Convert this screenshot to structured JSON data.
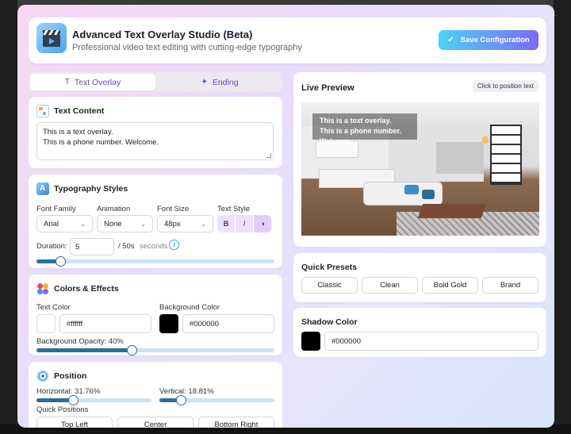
{
  "window": {
    "close_glyph": "×"
  },
  "header": {
    "icon": "clapperboard-icon",
    "title": "Advanced Text Overlay Studio (Beta)",
    "subtitle": "Professional video text editing with cutting-edge typography",
    "save_label": "Save Configuration",
    "save_glyph": "✓"
  },
  "tabs": [
    {
      "label": "Text Overlay",
      "glyph": "T",
      "active": true
    },
    {
      "label": "Ending",
      "glyph": "✦",
      "active": false
    }
  ],
  "text_content": {
    "title": "Text Content",
    "value": "This is a text overlay.\nThis is a phone number. Welcome."
  },
  "typography": {
    "title": "Typography Styles",
    "font_family_label": "Font Family",
    "font_family_value": "Arial",
    "animation_label": "Animation",
    "animation_value": "None",
    "font_size_label": "Font Size",
    "font_size_value": "48px",
    "text_style_label": "Text Style",
    "style_bold": "B",
    "style_italic": "I",
    "style_shadow": "◑",
    "duration_label": "Duration:",
    "duration_value": "5",
    "duration_total": "/ 50s",
    "duration_unit": "seconds",
    "duration_fraction": 0.1,
    "info_glyph": "i"
  },
  "colors": {
    "title": "Colors & Effects",
    "text_color_label": "Text Color",
    "text_color_value": "#ffffff",
    "bg_color_label": "Background Color",
    "bg_color_value": "#000000",
    "opacity_label": "Background Opacity: 40%",
    "opacity_fraction": 0.4
  },
  "position": {
    "title": "Position",
    "horizontal_label": "Horizontal: 31.76%",
    "horizontal_fraction": 0.3176,
    "vertical_label": "Vertical: 18.81%",
    "vertical_fraction": 0.1881,
    "quick_label": "Quick Positions",
    "quick": [
      "Top Left",
      "Center",
      "Bottom Right"
    ]
  },
  "preview": {
    "title": "Live Preview",
    "hint": "Click to position text",
    "overlay_text": "This is a text overlay.\nThis is a phone number. Welcome."
  },
  "presets": {
    "title": "Quick Presets",
    "items": [
      "Classic",
      "Clean",
      "Bold Gold",
      "Brand"
    ]
  },
  "shadow": {
    "title": "Shadow Color",
    "value": "#000000"
  }
}
